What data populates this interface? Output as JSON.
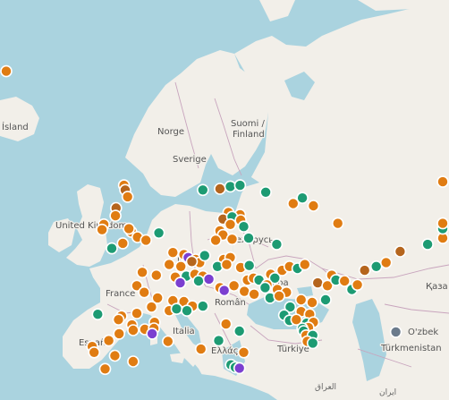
{
  "colors": {
    "sea": "#aad3df",
    "land": "#f2efe9",
    "border": "#c8a4bd",
    "orange": "#e07c12",
    "brown": "#b5651d",
    "teal": "#1d9b73",
    "purple": "#7b3fd0",
    "grey": "#6b7b8c"
  },
  "labels": {
    "island": "Ísland",
    "norge": "Norge",
    "suomi_1": "Suomi /",
    "suomi_2": "Finland",
    "sverige": "Sverige",
    "uk": "United Kingdom",
    "belarus": "Беларусь",
    "land_partial": "land",
    "france": "France",
    "ukraine": "Укра",
    "romania": "Român",
    "italia": "Italia",
    "espana": "España",
    "ellas": "Ελλάς",
    "turkiye": "Türkiye",
    "kaza": "Қаза",
    "ozbek": "O'zbek",
    "turkmenistan": "Türkmenistan",
    "iraq": "العراق",
    "iran": "ایران"
  },
  "markers": [
    {
      "c": "orange",
      "ll": [
        64.6,
        -157.1
      ]
    },
    {
      "c": "orange",
      "ll": [
        56.3,
        53.0
      ]
    },
    {
      "c": "orange",
      "ll": [
        56.0,
        -3.2
      ]
    },
    {
      "c": "brown",
      "ll": [
        55.6,
        -3.0
      ]
    },
    {
      "c": "orange",
      "ll": [
        55.0,
        -2.6
      ]
    },
    {
      "c": "brown",
      "ll": [
        54.0,
        -4.5
      ]
    },
    {
      "c": "orange",
      "ll": [
        53.3,
        -4.6
      ]
    },
    {
      "c": "orange",
      "ll": [
        52.5,
        -6.5
      ]
    },
    {
      "c": "orange",
      "ll": [
        52.0,
        -6.8
      ]
    },
    {
      "c": "orange",
      "ll": [
        51.8,
        -2.0
      ]
    },
    {
      "c": "orange",
      "ll": [
        51.3,
        -1.0
      ]
    },
    {
      "c": "orange",
      "ll": [
        51.0,
        0.4
      ]
    },
    {
      "c": "orange",
      "ll": [
        50.7,
        -3.4
      ]
    },
    {
      "c": "teal",
      "ll": [
        50.2,
        -5.2
      ]
    },
    {
      "c": "orange",
      "ll": [
        52.1,
        -2.4
      ]
    },
    {
      "c": "teal",
      "ll": [
        51.7,
        2.5
      ]
    },
    {
      "c": "teal",
      "ll": [
        55.6,
        9.7
      ]
    },
    {
      "c": "brown",
      "ll": [
        55.7,
        12.5
      ]
    },
    {
      "c": "teal",
      "ll": [
        55.9,
        14.2
      ]
    },
    {
      "c": "teal",
      "ll": [
        56.0,
        15.8
      ]
    },
    {
      "c": "teal",
      "ll": [
        55.4,
        20.0
      ]
    },
    {
      "c": "orange",
      "ll": [
        54.4,
        24.5
      ]
    },
    {
      "c": "teal",
      "ll": [
        54.9,
        26.0
      ]
    },
    {
      "c": "orange",
      "ll": [
        54.2,
        27.8
      ]
    },
    {
      "c": "orange",
      "ll": [
        52.6,
        31.8
      ]
    },
    {
      "c": "orange",
      "ll": [
        53.6,
        13.9
      ]
    },
    {
      "c": "orange",
      "ll": [
        53.4,
        15.8
      ]
    },
    {
      "c": "brown",
      "ll": [
        53.0,
        13.0
      ]
    },
    {
      "c": "teal",
      "ll": [
        53.2,
        14.5
      ]
    },
    {
      "c": "orange",
      "ll": [
        52.9,
        15.9
      ]
    },
    {
      "c": "orange",
      "ll": [
        52.5,
        14.2
      ]
    },
    {
      "c": "teal",
      "ll": [
        52.3,
        16.4
      ]
    },
    {
      "c": "orange",
      "ll": [
        51.9,
        12.5
      ]
    },
    {
      "c": "orange",
      "ll": [
        51.5,
        13.0
      ]
    },
    {
      "c": "orange",
      "ll": [
        51.1,
        14.5
      ]
    },
    {
      "c": "orange",
      "ll": [
        51.0,
        11.8
      ]
    },
    {
      "c": "teal",
      "ll": [
        51.2,
        17.2
      ]
    },
    {
      "c": "teal",
      "ll": [
        50.6,
        21.8
      ]
    },
    {
      "c": "orange",
      "ll": [
        49.8,
        4.8
      ]
    },
    {
      "c": "orange",
      "ll": [
        49.6,
        6.6
      ]
    },
    {
      "c": "purple",
      "ll": [
        49.3,
        7.3
      ]
    },
    {
      "c": "orange",
      "ll": [
        49.1,
        8.5
      ]
    },
    {
      "c": "orange",
      "ll": [
        48.8,
        9.2
      ]
    },
    {
      "c": "brown",
      "ll": [
        48.9,
        7.9
      ]
    },
    {
      "c": "teal",
      "ll": [
        49.5,
        10.0
      ]
    },
    {
      "c": "orange",
      "ll": [
        49.1,
        13.1
      ]
    },
    {
      "c": "orange",
      "ll": [
        49.3,
        14.2
      ]
    },
    {
      "c": "teal",
      "ll": [
        48.4,
        12.1
      ]
    },
    {
      "c": "orange",
      "ll": [
        48.6,
        4.2
      ]
    },
    {
      "c": "orange",
      "ll": [
        48.4,
        6.1
      ]
    },
    {
      "c": "orange",
      "ll": [
        48.6,
        13.6
      ]
    },
    {
      "c": "orange",
      "ll": [
        48.3,
        15.9
      ]
    },
    {
      "c": "teal",
      "ll": [
        48.5,
        17.3
      ]
    },
    {
      "c": "orange",
      "ll": [
        47.8,
        -0.2
      ]
    },
    {
      "c": "orange",
      "ll": [
        47.5,
        2.1
      ]
    },
    {
      "c": "teal",
      "ll": [
        47.4,
        7.0
      ]
    },
    {
      "c": "orange",
      "ll": [
        47.3,
        5.2
      ]
    },
    {
      "c": "orange",
      "ll": [
        47.6,
        8.4
      ]
    },
    {
      "c": "orange",
      "ll": [
        47.4,
        9.7
      ]
    },
    {
      "c": "purple",
      "ll": [
        46.7,
        6.0
      ]
    },
    {
      "c": "teal",
      "ll": [
        46.9,
        9.0
      ]
    },
    {
      "c": "purple",
      "ll": [
        47.1,
        10.7
      ]
    },
    {
      "c": "orange",
      "ll": [
        46.2,
        12.5
      ]
    },
    {
      "c": "purple",
      "ll": [
        45.9,
        13.2
      ]
    },
    {
      "c": "orange",
      "ll": [
        46.4,
        14.8
      ]
    },
    {
      "c": "orange",
      "ll": [
        45.8,
        16.5
      ]
    },
    {
      "c": "orange",
      "ll": [
        47.0,
        17.0
      ]
    },
    {
      "c": "orange",
      "ll": [
        47.2,
        18.0
      ]
    },
    {
      "c": "teal",
      "ll": [
        47.0,
        18.9
      ]
    },
    {
      "c": "orange",
      "ll": [
        47.6,
        20.8
      ]
    },
    {
      "c": "teal",
      "ll": [
        47.2,
        21.5
      ]
    },
    {
      "c": "orange",
      "ll": [
        46.5,
        20.2
      ]
    },
    {
      "c": "orange",
      "ll": [
        45.5,
        18.1
      ]
    },
    {
      "c": "teal",
      "ll": [
        46.2,
        19.9
      ]
    },
    {
      "c": "orange",
      "ll": [
        46.0,
        21.9
      ]
    },
    {
      "c": "orange",
      "ll": [
        45.7,
        23.4
      ]
    },
    {
      "c": "teal",
      "ll": [
        45.1,
        20.7
      ]
    },
    {
      "c": "orange",
      "ll": [
        45.3,
        22.2
      ]
    },
    {
      "c": "orange",
      "ll": [
        48.0,
        22.7
      ]
    },
    {
      "c": "orange",
      "ll": [
        48.4,
        23.9
      ]
    },
    {
      "c": "teal",
      "ll": [
        48.2,
        25.2
      ]
    },
    {
      "c": "orange",
      "ll": [
        48.6,
        26.4
      ]
    },
    {
      "c": "orange",
      "ll": [
        44.9,
        25.8
      ]
    },
    {
      "c": "orange",
      "ll": [
        44.6,
        27.6
      ]
    },
    {
      "c": "teal",
      "ll": [
        44.1,
        24.0
      ]
    },
    {
      "c": "orange",
      "ll": [
        43.6,
        25.8
      ]
    },
    {
      "c": "orange",
      "ll": [
        43.3,
        27.2
      ]
    },
    {
      "c": "teal",
      "ll": [
        43.2,
        23.0
      ]
    },
    {
      "c": "teal",
      "ll": [
        42.6,
        23.9
      ]
    },
    {
      "c": "orange",
      "ll": [
        42.7,
        25.0
      ]
    },
    {
      "c": "teal",
      "ll": [
        42.3,
        26.7
      ]
    },
    {
      "c": "orange",
      "ll": [
        42.4,
        27.8
      ]
    },
    {
      "c": "orange",
      "ll": [
        41.8,
        27.0
      ]
    },
    {
      "c": "teal",
      "ll": [
        41.7,
        26.0
      ]
    },
    {
      "c": "teal",
      "ll": [
        41.4,
        26.2
      ]
    },
    {
      "c": "orange",
      "ll": [
        40.9,
        26.6
      ]
    },
    {
      "c": "teal",
      "ll": [
        40.9,
        27.7
      ]
    },
    {
      "c": "orange",
      "ll": [
        40.2,
        26.8
      ]
    },
    {
      "c": "teal",
      "ll": [
        40.0,
        27.7
      ]
    },
    {
      "c": "teal",
      "ll": [
        44.9,
        29.8
      ]
    },
    {
      "c": "brown",
      "ll": [
        46.7,
        28.5
      ]
    },
    {
      "c": "orange",
      "ll": [
        46.4,
        30.1
      ]
    },
    {
      "c": "orange",
      "ll": [
        47.5,
        30.8
      ]
    },
    {
      "c": "teal",
      "ll": [
        47.0,
        31.5
      ]
    },
    {
      "c": "orange",
      "ll": [
        46.9,
        32.9
      ]
    },
    {
      "c": "teal",
      "ll": [
        46.0,
        34.1
      ]
    },
    {
      "c": "orange",
      "ll": [
        46.5,
        35.0
      ]
    },
    {
      "c": "brown",
      "ll": [
        48.0,
        36.2
      ]
    },
    {
      "c": "teal",
      "ll": [
        48.4,
        38.1
      ]
    },
    {
      "c": "orange",
      "ll": [
        48.8,
        39.7
      ]
    },
    {
      "c": "brown",
      "ll": [
        49.9,
        42.0
      ]
    },
    {
      "c": "teal",
      "ll": [
        50.6,
        46.5
      ]
    },
    {
      "c": "orange",
      "ll": [
        51.2,
        49.4
      ]
    },
    {
      "c": "teal",
      "ll": [
        52.1,
        51.0
      ]
    },
    {
      "c": "orange",
      "ll": [
        52.6,
        54.3
      ]
    },
    {
      "c": "grey",
      "ll": [
        41.3,
        41.3
      ]
    },
    {
      "c": "orange",
      "ll": [
        46.4,
        -1.1
      ]
    },
    {
      "c": "orange",
      "ll": [
        45.7,
        0.1
      ]
    },
    {
      "c": "orange",
      "ll": [
        45.1,
        2.3
      ]
    },
    {
      "c": "orange",
      "ll": [
        44.8,
        4.8
      ]
    },
    {
      "c": "orange",
      "ll": [
        44.7,
        6.6
      ]
    },
    {
      "c": "orange",
      "ll": [
        44.2,
        8.0
      ]
    },
    {
      "c": "teal",
      "ll": [
        44.2,
        9.7
      ]
    },
    {
      "c": "orange",
      "ll": [
        43.7,
        4.2
      ]
    },
    {
      "c": "teal",
      "ll": [
        43.9,
        5.4
      ]
    },
    {
      "c": "teal",
      "ll": [
        43.7,
        7.1
      ]
    },
    {
      "c": "orange",
      "ll": [
        44.1,
        1.3
      ]
    },
    {
      "c": "orange",
      "ll": [
        43.4,
        -1.1
      ]
    },
    {
      "c": "orange",
      "ll": [
        43.1,
        -3.6
      ]
    },
    {
      "c": "teal",
      "ll": [
        43.3,
        -7.5
      ]
    },
    {
      "c": "orange",
      "ll": [
        42.7,
        -4.1
      ]
    },
    {
      "c": "orange",
      "ll": [
        42.1,
        -1.9
      ]
    },
    {
      "c": "orange",
      "ll": [
        42.4,
        1.8
      ]
    },
    {
      "c": "orange",
      "ll": [
        41.6,
        0.2
      ]
    },
    {
      "c": "orange",
      "ll": [
        41.7,
        1.7
      ]
    },
    {
      "c": "purple",
      "ll": [
        41.1,
        1.4
      ]
    },
    {
      "c": "orange",
      "ll": [
        41.5,
        -1.7
      ]
    },
    {
      "c": "orange",
      "ll": [
        41.1,
        -4.0
      ]
    },
    {
      "c": "orange",
      "ll": [
        40.3,
        -5.7
      ]
    },
    {
      "c": "orange",
      "ll": [
        39.6,
        -8.4
      ]
    },
    {
      "c": "orange",
      "ll": [
        38.9,
        -8.1
      ]
    },
    {
      "c": "orange",
      "ll": [
        38.5,
        -4.7
      ]
    },
    {
      "c": "orange",
      "ll": [
        37.8,
        -1.7
      ]
    },
    {
      "c": "orange",
      "ll": [
        36.9,
        -6.3
      ]
    },
    {
      "c": "orange",
      "ll": [
        40.2,
        4.0
      ]
    },
    {
      "c": "teal",
      "ll": [
        40.3,
        12.3
      ]
    },
    {
      "c": "teal",
      "ll": [
        41.4,
        15.7
      ]
    },
    {
      "c": "orange",
      "ll": [
        39.3,
        9.4
      ]
    },
    {
      "c": "orange",
      "ll": [
        38.9,
        16.4
      ]
    },
    {
      "c": "teal",
      "ll": [
        37.4,
        14.3
      ]
    },
    {
      "c": "teal",
      "ll": [
        37.1,
        15.0
      ]
    },
    {
      "c": "purple",
      "ll": [
        37.0,
        15.7
      ]
    },
    {
      "c": "orange",
      "ll": [
        42.2,
        13.5
      ]
    }
  ]
}
